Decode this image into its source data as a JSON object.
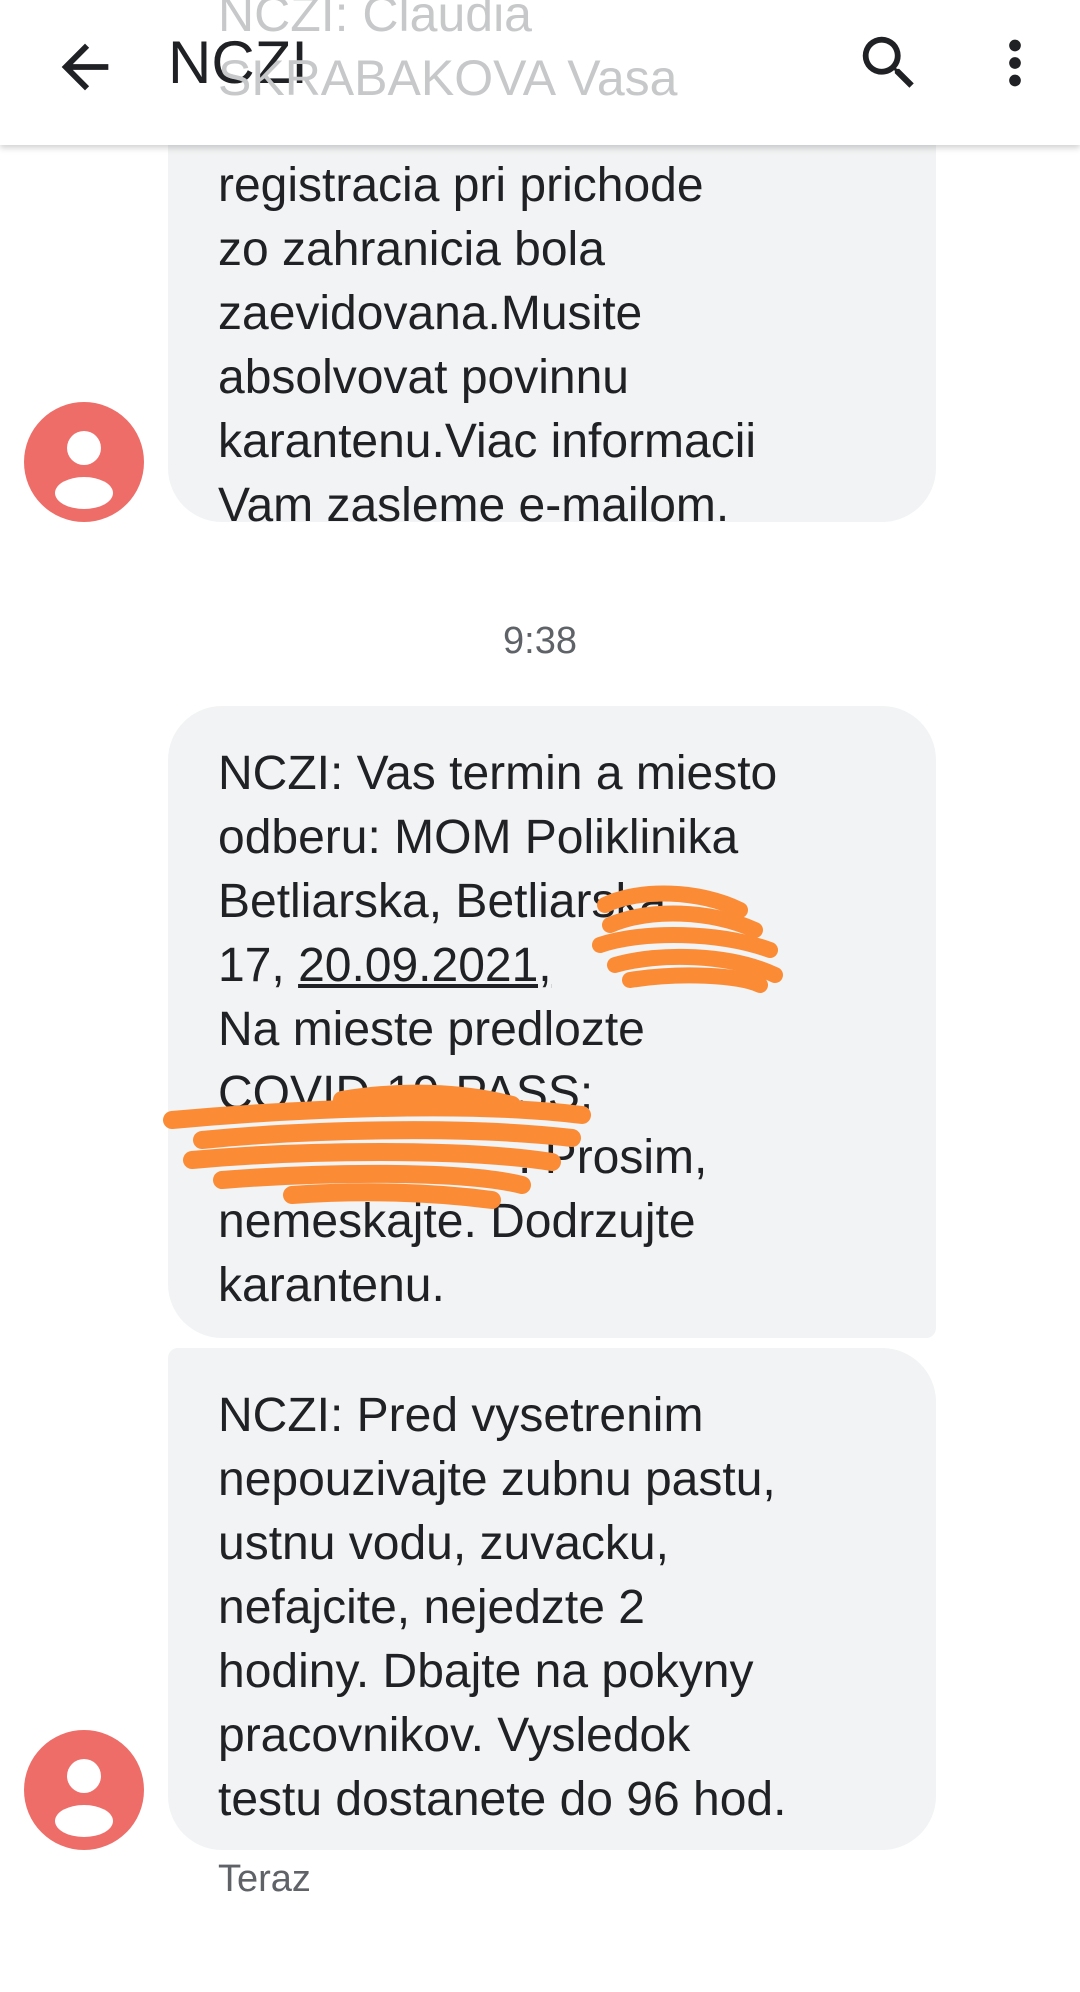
{
  "app_bar": {
    "title": "NCZI",
    "back_icon": "arrow-back-icon",
    "search_icon": "search-icon",
    "more_icon": "more-vert-icon"
  },
  "peek_text": "NCZI: Claudia\nSKRABAKOVA Vasa",
  "messages": [
    {
      "lines": [
        "registracia pri prichode",
        "zo zahranicia bola",
        "zaevidovana.Musite",
        "absolvovat povinnu",
        "karantenu.Viac informacii",
        "Vam zasleme e-mailom."
      ]
    },
    {
      "lines": [
        "NCZI: Vas termin a miesto",
        "odberu: MOM Poliklinika",
        "Betliarska, Betliarska",
        "17, ",
        "Na mieste predlozte",
        "COVID-19-PASS:",
        "  . Prosim,",
        "nemeskajte. Dodrzujte",
        "karantenu."
      ],
      "date_link": "20.09.2021,"
    },
    {
      "lines": [
        "NCZI: Pred vysetrenim",
        "nepouzivajte zubnu pastu,",
        "ustnu vodu, zuvacku,",
        "nefajcite, nejedzte 2",
        "hodiny. Dbajte na pokyny",
        "pracovnikov. Vysledok",
        "testu dostanete do 96 hod."
      ]
    }
  ],
  "timestamp": "9:38",
  "status_label": "Teraz",
  "colors": {
    "avatar": "#ef6d68",
    "bubble": "#f1f3f4",
    "redaction": "#fb8c35"
  }
}
